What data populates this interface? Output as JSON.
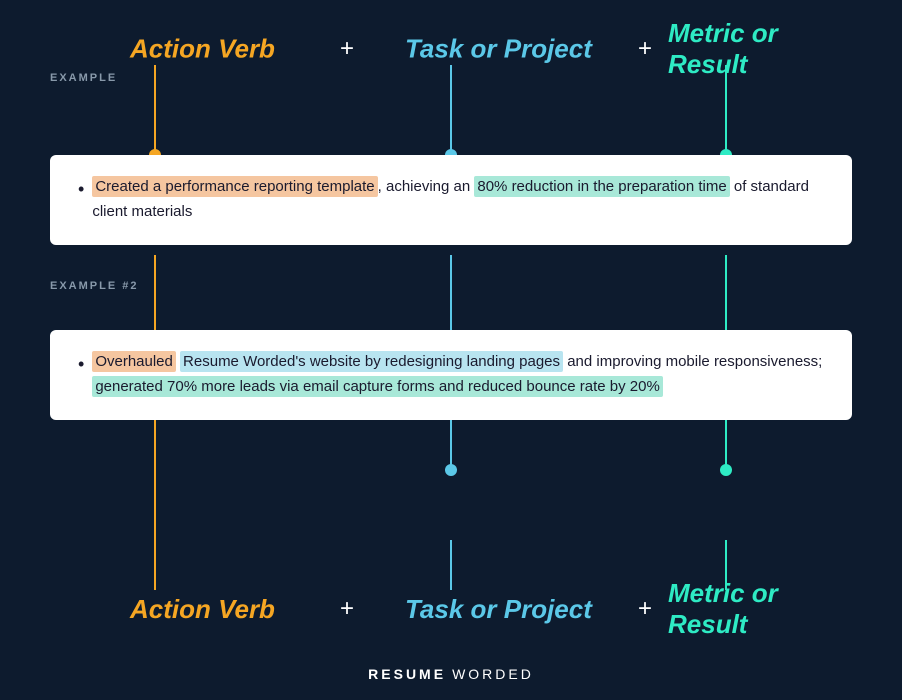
{
  "header": {
    "action_verb_label": "Action Verb",
    "plus1": "+",
    "task_label": "Task or Project",
    "plus2": "+",
    "metric_label": "Metric or Result"
  },
  "example1": {
    "section_label": "EXAMPLE",
    "text_parts": [
      {
        "text": "Created a performance reporting template",
        "highlight": "orange"
      },
      {
        "text": ", achieving an ",
        "highlight": "none"
      },
      {
        "text": "80% reduction in the preparation time",
        "highlight": "teal"
      },
      {
        "text": " of standard client materials",
        "highlight": "none"
      }
    ],
    "full_text": "Created a performance reporting template, achieving an 80% reduction in the preparation time of standard client materials"
  },
  "example2": {
    "section_label": "EXAMPLE #2",
    "full_text": "Overhauled Resume Worded's website by redesigning landing pages and improving mobile responsiveness; generated 70% more leads via email capture forms and reduced bounce rate by 20%"
  },
  "footer": {
    "resume": "RESUME",
    "worded": "WORDED"
  },
  "colors": {
    "action_verb": "#f5a623",
    "task": "#5bc8e8",
    "metric": "#2eebc4",
    "background": "#0d1b2e",
    "highlight_orange": "#f5c6a0",
    "highlight_blue": "#b8e4f0",
    "highlight_teal": "#a8e8d8"
  }
}
